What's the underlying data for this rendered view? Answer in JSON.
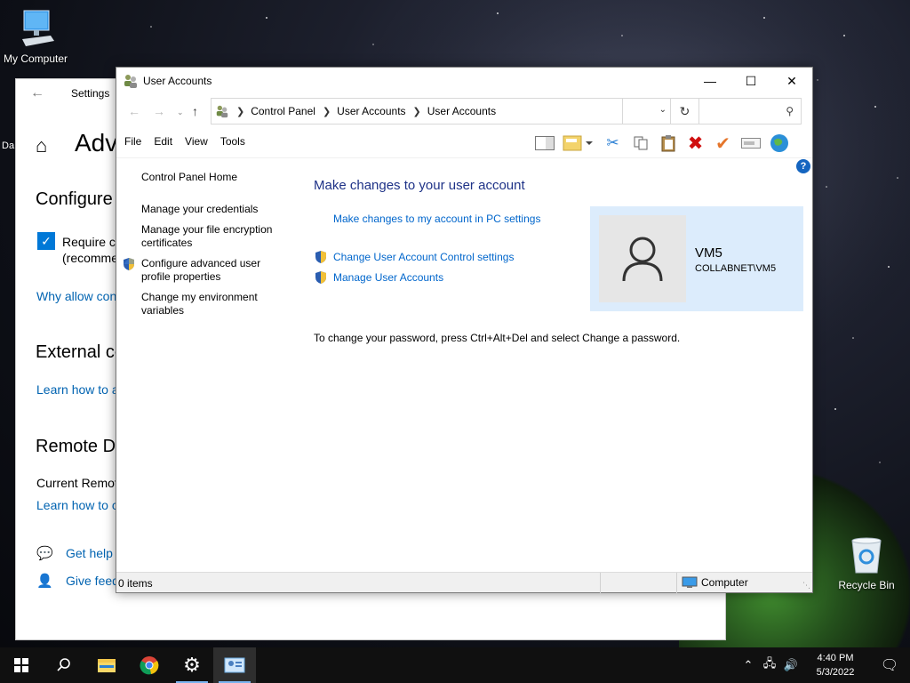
{
  "desktop": {
    "my_computer_label": "My Computer",
    "recycle_bin_label": "Recycle Bin",
    "partial_label": "Da"
  },
  "settings_window": {
    "title": "Settings",
    "heading": "Adv",
    "section_configure": "Configure",
    "checkbox_label_line1": "Require co",
    "checkbox_label_line2": "(recomme",
    "why_link": "Why allow con",
    "section_external": "External co",
    "learn_link_1": "Learn how to a",
    "section_remote": "Remote De",
    "current_remote": "Current Remot",
    "learn_link_2": "Learn how to c",
    "get_help": "Get help",
    "give_feedback": "Give feed"
  },
  "window": {
    "title": "User Accounts",
    "breadcrumb": [
      "Control Panel",
      "User Accounts",
      "User Accounts"
    ],
    "search_placeholder": "",
    "menu": [
      "File",
      "Edit",
      "View",
      "Tools"
    ]
  },
  "left_nav": {
    "home": "Control Panel Home",
    "credentials": "Manage your credentials",
    "encryption_line1": "Manage your file encryption",
    "encryption_line2": "certificates",
    "advanced_line1": "Configure advanced user",
    "advanced_line2": "profile properties",
    "env_line1": "Change my environment",
    "env_line2": "variables"
  },
  "content": {
    "title": "Make changes to your user account",
    "pc_settings_link": "Make changes to my account in PC settings",
    "uac_link": "Change User Account Control settings",
    "manage_link": "Manage User Accounts",
    "password_note": "To change your password, press Ctrl+Alt+Del and select Change a password."
  },
  "account": {
    "name": "VM5",
    "domain_user": "COLLABNET\\VM5"
  },
  "status": {
    "items": "0 items",
    "location": "Computer"
  },
  "taskbar": {
    "time": "4:40 PM",
    "date": "5/3/2022"
  },
  "colors": {
    "link": "#0066cc",
    "title_blue": "#1e3287",
    "account_bg": "#dcecfc",
    "accent": "#0078d7"
  }
}
